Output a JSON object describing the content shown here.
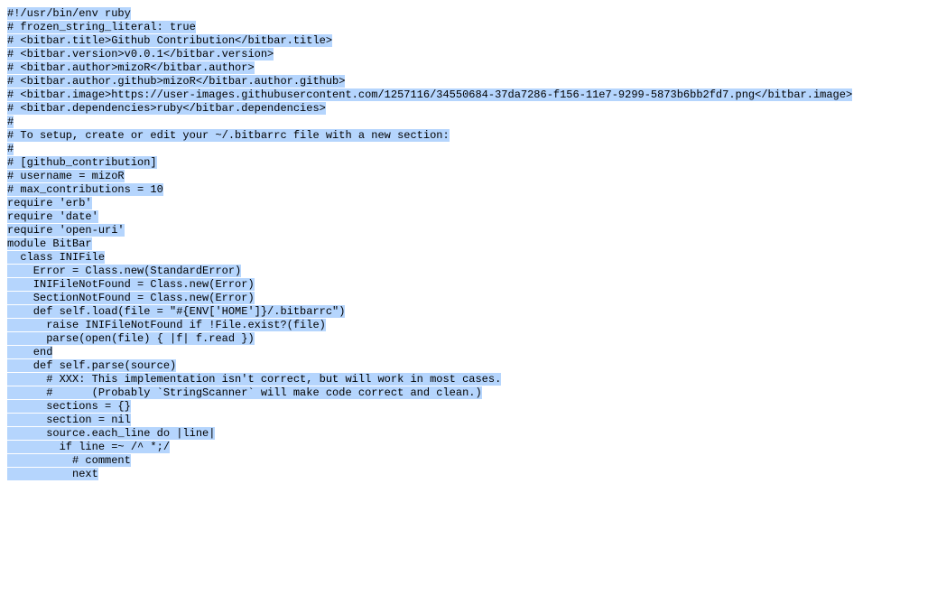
{
  "code_lines": [
    "#!/usr/bin/env ruby",
    "# frozen_string_literal: true",
    "",
    "# <bitbar.title>Github Contribution</bitbar.title>",
    "# <bitbar.version>v0.0.1</bitbar.version>",
    "# <bitbar.author>mizoR</bitbar.author>",
    "# <bitbar.author.github>mizoR</bitbar.author.github>",
    "# <bitbar.image>https://user-images.githubusercontent.com/1257116/34550684-37da7286-f156-11e7-9299-5873b6bb2fd7.png</bitbar.image>",
    "# <bitbar.dependencies>ruby</bitbar.dependencies>",
    "#",
    "# To setup, create or edit your ~/.bitbarrc file with a new section:",
    "#",
    "# [github_contribution]",
    "# username = mizoR",
    "# max_contributions = 10",
    "",
    "require 'erb'",
    "require 'date'",
    "require 'open-uri'",
    "",
    "module BitBar",
    "  class INIFile",
    "    Error = Class.new(StandardError)",
    "",
    "    INIFileNotFound = Class.new(Error)",
    "",
    "    SectionNotFound = Class.new(Error)",
    "",
    "    def self.load(file = \"#{ENV['HOME']}/.bitbarrc\")",
    "      raise INIFileNotFound if !File.exist?(file)",
    "",
    "      parse(open(file) { |f| f.read })",
    "    end",
    "",
    "    def self.parse(source)",
    "      # XXX: This implementation isn't correct, but will work in most cases.",
    "      #      (Probably `StringScanner` will make code correct and clean.)",
    "      sections = {}",
    "",
    "      section = nil",
    "",
    "      source.each_line do |line|",
    "        if line =~ /^ *;/",
    "          # comment",
    "          next"
  ]
}
